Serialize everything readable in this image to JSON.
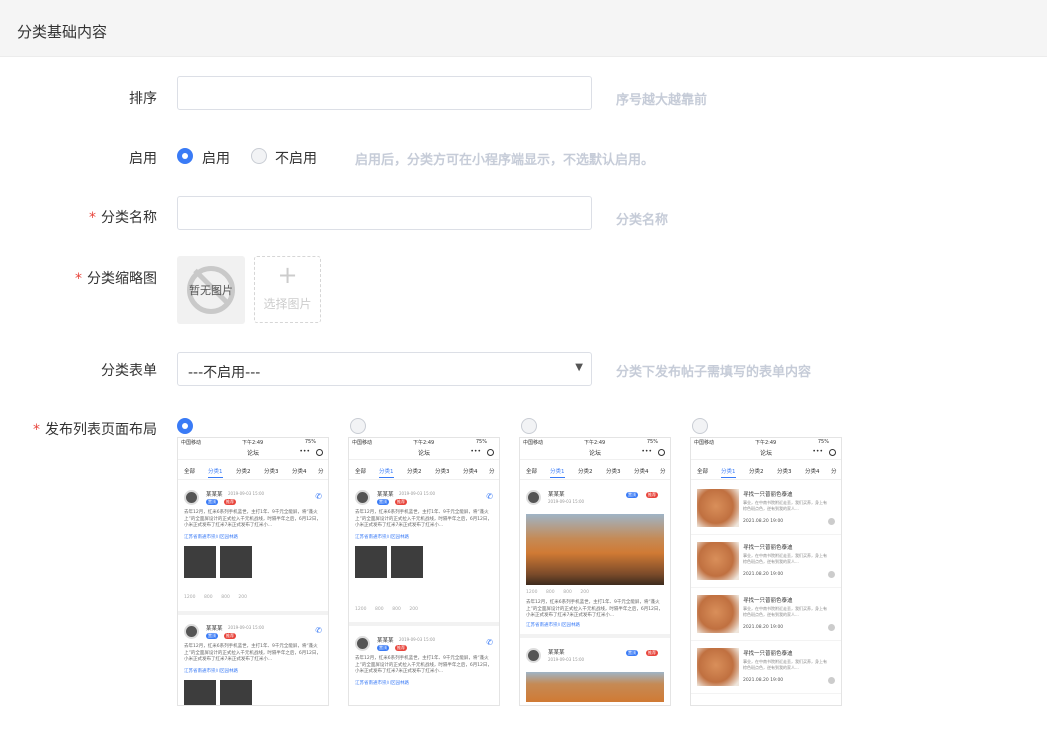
{
  "header": {
    "title": "分类基础内容"
  },
  "sort": {
    "label": "排序",
    "value": "",
    "hint": "序号越大越靠前"
  },
  "enable": {
    "label": "启用",
    "options": [
      {
        "label": "启用",
        "selected": true
      },
      {
        "label": "不启用",
        "selected": false
      }
    ],
    "hint": "启用后，分类方可在小程序端显示，不选默认启用。"
  },
  "name": {
    "required": "*",
    "label": "分类名称",
    "value": "",
    "hint": "分类名称"
  },
  "thumb": {
    "required": "*",
    "label": "分类缩略图",
    "noimage": "暂无图片",
    "plus": "+",
    "choose": "选择图片"
  },
  "form": {
    "label": "分类表单",
    "value": "---不启用---",
    "hint": "分类下发布帖子需填写的表单内容"
  },
  "layout": {
    "required": "*",
    "label": "发布列表页面布局",
    "options": [
      {
        "selected": true
      },
      {
        "selected": false
      },
      {
        "selected": false
      },
      {
        "selected": false
      }
    ]
  },
  "preview": {
    "carrier": "中国移动",
    "time": "下午2:49",
    "battery": "75%",
    "title": "论坛",
    "dots": "•••",
    "tabs": [
      "全部",
      "分类1",
      "分类2",
      "分类3",
      "分类4",
      "分"
    ],
    "user": "某某某",
    "date": "2019-09-03 15:00",
    "tag1": "置顶",
    "tag2": "推荐",
    "text": "去年12月，红米6系列手机蓝世，主打1年、9千元全能屏，将“蓬火上”的全面屏设计的正式拉入千元机战线，时隔半年之后，6月12日，小米正式发布了红米7米正式发布了红米小...",
    "location": "江苏省南通市崇川区园林路",
    "stats": [
      "1200",
      "800",
      "800",
      "200"
    ],
    "list_title": "寻找一只普丽色泰迪",
    "list_desc": "事业，在中南书院附近走丢，我们买养，身上有棕色斑点色，逆有到我的家人...",
    "list_date": "2021.08.20  19:00"
  },
  "colors": {
    "accent": "#3a7bf6",
    "required": "#e8453c",
    "hint": "#c6ccd8"
  }
}
